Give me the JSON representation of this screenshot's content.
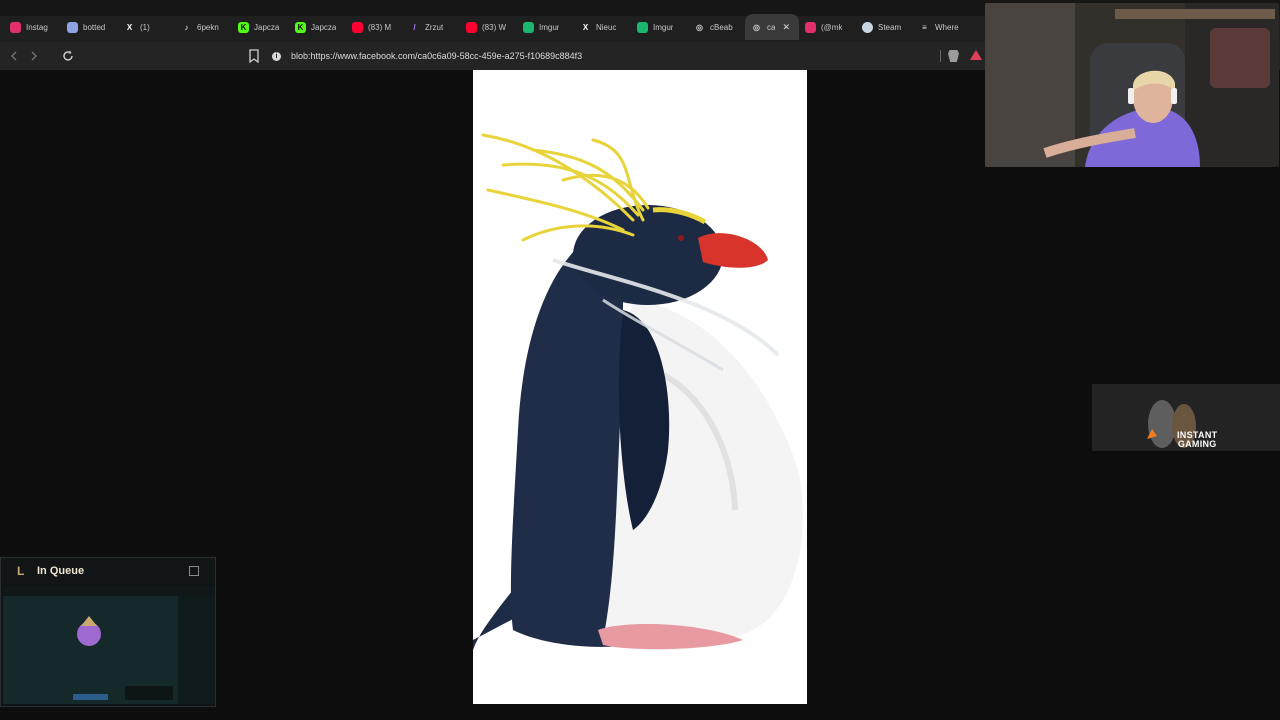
{
  "browser": {
    "tabs": [
      {
        "label": "Instag",
        "icon": "instagram-icon",
        "color": "#e1306c"
      },
      {
        "label": "botted",
        "icon": "discord-icon",
        "color": "#8ea1e1"
      },
      {
        "label": "(1)",
        "icon": "x-icon",
        "color": "#ffffff"
      },
      {
        "label": "6pekn",
        "icon": "tiktok-icon",
        "color": "#ffffff"
      },
      {
        "label": "Japcza",
        "icon": "kick-icon",
        "color": "#53fc18"
      },
      {
        "label": "Japcza",
        "icon": "kick-icon",
        "color": "#53fc18"
      },
      {
        "label": "(83) M",
        "icon": "youtube-icon",
        "color": "#ff0033"
      },
      {
        "label": "Zrzut",
        "icon": "feather-icon",
        "color": "#b07cff"
      },
      {
        "label": "(83) W",
        "icon": "youtube-icon",
        "color": "#ff0033"
      },
      {
        "label": "Imgur",
        "icon": "imgur-icon",
        "color": "#1bb76e"
      },
      {
        "label": "Nieuc",
        "icon": "x-icon",
        "color": "#ffffff"
      },
      {
        "label": "Imgur",
        "icon": "imgur-icon",
        "color": "#1bb76e"
      },
      {
        "label": "cBeab",
        "icon": "globe-icon",
        "color": "#cfcfcf"
      },
      {
        "label": "ca",
        "icon": "globe-icon",
        "color": "#cfcfcf",
        "active": true
      },
      {
        "label": "(@mk",
        "icon": "instagram-icon",
        "color": "#e1306c"
      },
      {
        "label": "Steam",
        "icon": "steam-icon",
        "color": "#c7d5e0"
      },
      {
        "label": "Where",
        "icon": "stack-icon",
        "color": "#e0e0e0"
      }
    ],
    "close_glyph": "✕",
    "url": "blob:https://www.facebook.com/ca0c6a09-58cc-459e-a275-f10689c884f3",
    "info_glyph": "i"
  },
  "overlays": {
    "instant_gaming": {
      "line1": "INSTANT",
      "line2": "GAMING"
    },
    "lol": {
      "logo": "L",
      "title": "In Queue"
    }
  },
  "colors": {
    "penguin_crest": "#e8d43a",
    "penguin_beak": "#d9342b",
    "penguin_back": "#1d2b45",
    "lol_gold": "#c8aa6e"
  }
}
